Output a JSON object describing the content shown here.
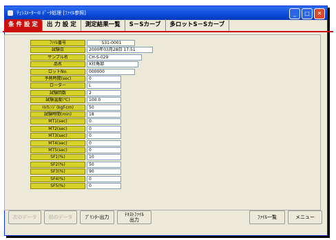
{
  "window": {
    "title": "ﾁｪｼｽﾒｰﾀｰ-II ﾃﾞｰﾀ処理 [ﾌｧｲﾙ参照]"
  },
  "tabs": [
    {
      "label": "条 件 設 定",
      "active": true
    },
    {
      "label": "出 力 設 定",
      "active": false
    },
    {
      "label": "測定結果一覧",
      "active": false
    },
    {
      "label": "S－Sカーブ",
      "active": false
    },
    {
      "label": "多ロットS－Sカーブ",
      "active": false
    }
  ],
  "fields": [
    {
      "label": "ﾌｧｲﾙ番号",
      "value": "S31-0001"
    },
    {
      "label": "試験日",
      "value": "2000年03月28日 17:51"
    },
    {
      "label": "サンプル名",
      "value": "CH-S-029"
    },
    {
      "label": "品名",
      "value": "X社角部"
    },
    {
      "label": "ロットNo.",
      "value": "000000"
    },
    {
      "label": "予熱時間(sec)",
      "value": "0"
    },
    {
      "label": "ローター",
      "value": "L"
    },
    {
      "label": "試験回数",
      "value": "2"
    },
    {
      "label": "試験温度(℃)",
      "value": "100.0"
    },
    {
      "label": "ﾄﾙｸﾚﾝｼﾞ(kgf-cm)",
      "value": "50"
    },
    {
      "label": "試験時間(min)",
      "value": "18"
    },
    {
      "label": "MT1(sec)",
      "value": "0"
    },
    {
      "label": "MT2(sec)",
      "value": "0"
    },
    {
      "label": "MT3(sec)",
      "value": "0"
    },
    {
      "label": "MT4(sec)",
      "value": "0"
    },
    {
      "label": "MT5(sec)",
      "value": "0"
    },
    {
      "label": "SF1(%)",
      "value": "10"
    },
    {
      "label": "SF2(%)",
      "value": "50"
    },
    {
      "label": "SF3(%)",
      "value": "90"
    },
    {
      "label": "SF4(%)",
      "value": "0"
    },
    {
      "label": "SF5(%)",
      "value": "0"
    }
  ],
  "buttons": {
    "next_data": "次のデータ",
    "prev_data": "前のデータ",
    "printer_output": "ﾌﾟﾘﾝﾀｰ出力",
    "text_file_output": "ﾃｷｽﾄﾌｧｲﾙ\n出力",
    "file_list": "ﾌｧｲﾙ一覧",
    "menu": "メニュー"
  }
}
